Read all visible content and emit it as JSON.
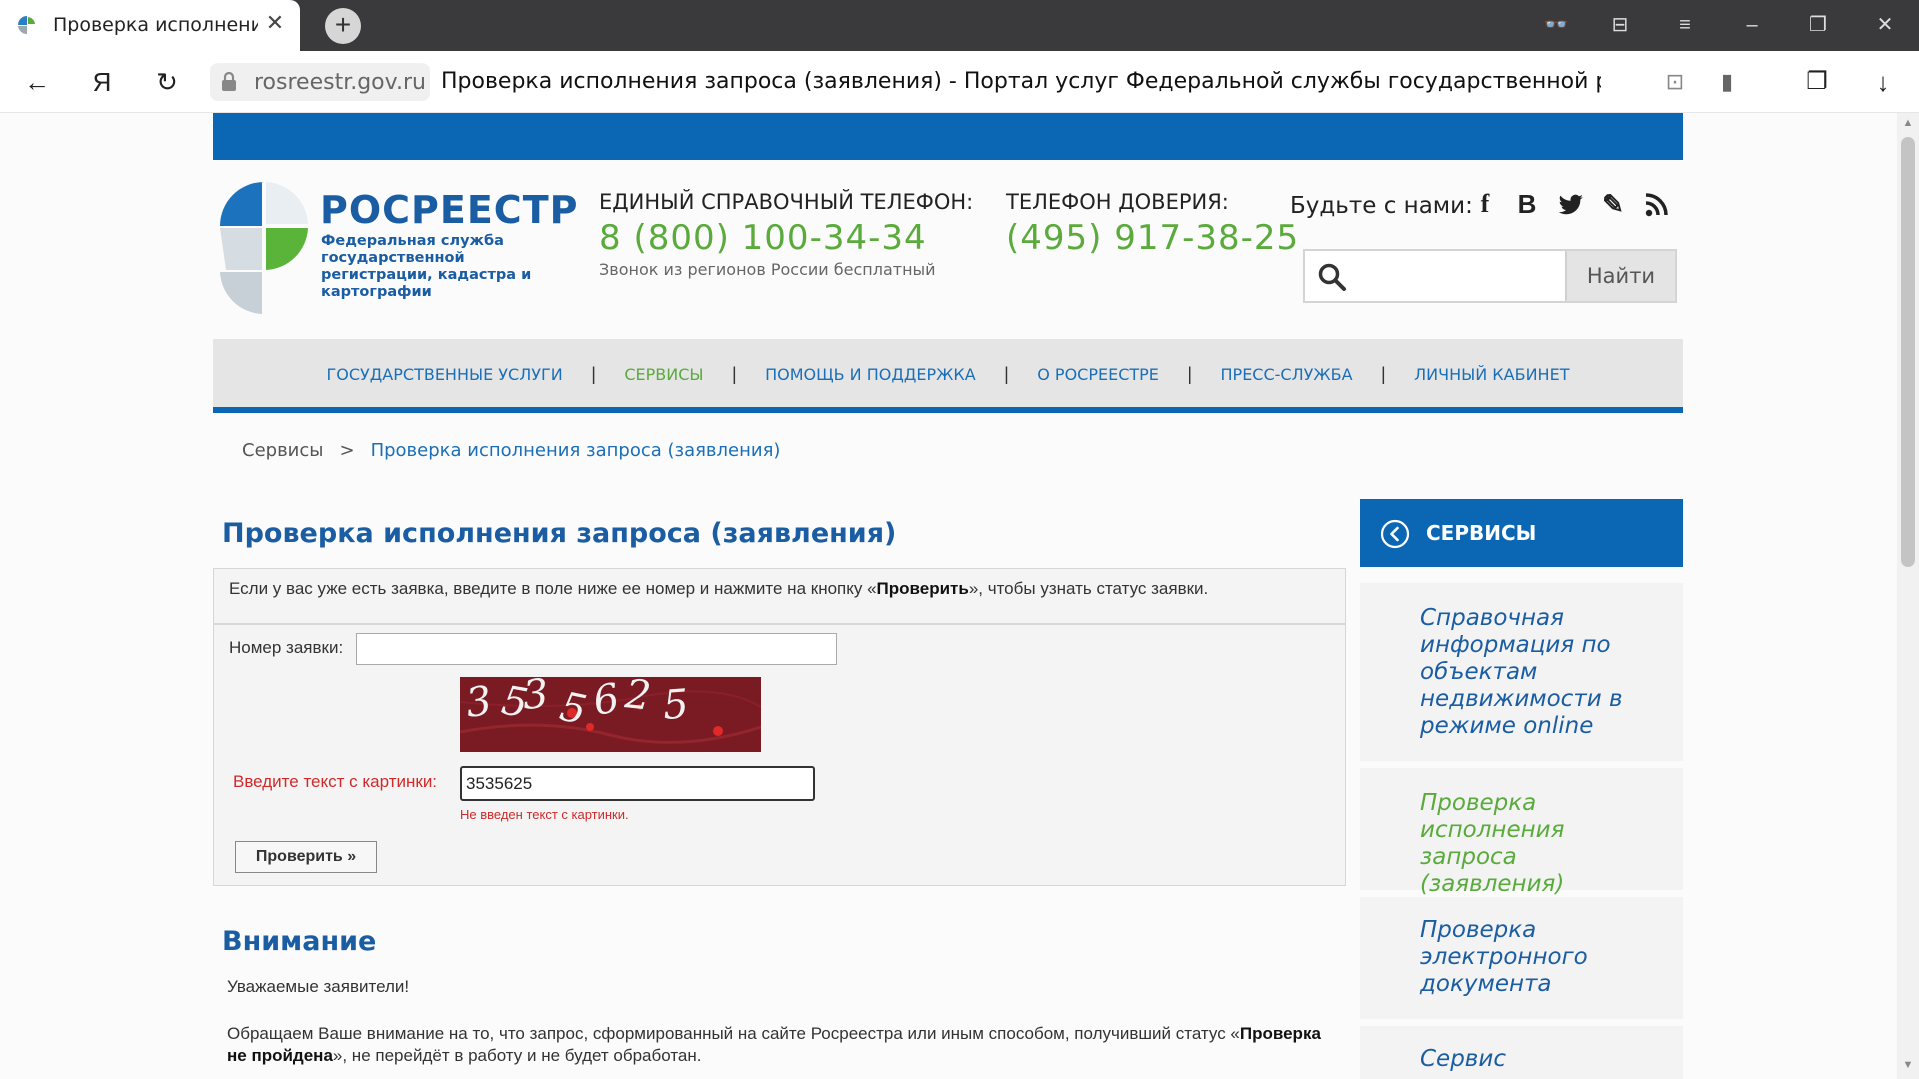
{
  "browser": {
    "tab_title": "Проверка исполнения запроса (заявления)",
    "tab_close": "✕",
    "new_tab": "+",
    "domain": "rosreestr.gov.ru",
    "page_title": "Проверка исполнения запроса (заявления) - Портал услуг Федеральной службы государственной регистрации, кадастра и картографии",
    "nav": {
      "back": "←",
      "yandex": "Я",
      "reload": "↻"
    },
    "right_icons": {
      "translate": "⊡",
      "bookmark": "▮",
      "collections": "❐",
      "download": "↓"
    },
    "window": {
      "reader": "👓",
      "bookmarks": "⊟",
      "menu": "≡",
      "minimize": "–",
      "restore": "❐",
      "close": "✕"
    }
  },
  "header": {
    "logo_name": "РОСРЕЕСТР",
    "logo_subtitle": "Федеральная служба государственной регистрации, кадастра и картографии",
    "hotline_label": "ЕДИНЫЙ СПРАВОЧНЫЙ ТЕЛЕФОН:",
    "hotline_number": "8 (800) 100-34-34",
    "hotline_note": "Звонок из регионов России бесплатный",
    "trust_label": "ТЕЛЕФОН ДОВЕРИЯ:",
    "trust_number": "(495) 917-38-25",
    "social_label": "Будьте с нами:",
    "social_icons": [
      "facebook-icon",
      "vk-icon",
      "twitter-icon",
      "livejournal-icon",
      "rss-icon"
    ],
    "social_glyphs": {
      "facebook": "f",
      "vk": "B",
      "twitter": "🐦",
      "livejournal": "✎",
      "rss": "◔"
    },
    "search_button": "Найти"
  },
  "menu": {
    "items": [
      {
        "label": "ГОСУДАРСТВЕННЫЕ УСЛУГИ"
      },
      {
        "label": "СЕРВИСЫ"
      },
      {
        "label": "ПОМОЩЬ И ПОДДЕРЖКА"
      },
      {
        "label": "О РОСРЕЕСТРЕ"
      },
      {
        "label": "ПРЕСС-СЛУЖБА"
      },
      {
        "label": "ЛИЧНЫЙ КАБИНЕТ"
      }
    ],
    "separator": "|"
  },
  "breadcrumb": {
    "first": "Сервисы",
    "separator": ">",
    "current": "Проверка исполнения запроса (заявления)"
  },
  "main": {
    "title": "Проверка исполнения запроса (заявления)",
    "intro_before": "Если у вас уже есть заявка, введите в поле ниже ее номер и нажмите на кнопку «",
    "intro_bold": "Проверить",
    "intro_after": "», чтобы узнать статус заявки.",
    "number_label": "Номер заявки:",
    "number_value": "",
    "captcha_text": "3535625",
    "captcha_label": "Введите текст с картинки:",
    "captcha_value": "3535625",
    "captcha_error": "Не введен текст с картинки.",
    "check_button": "Проверить »",
    "attention_title": "Внимание",
    "greeting": "Уважаемые заявители!",
    "notice_before": "Обращаем Ваше внимание на то, что запрос, сформированный на сайте Росреестра или иным способом, получивший статус «",
    "notice_bold": "Проверка не пройдена",
    "notice_after": "», не перейдёт в работу и не будет обработан."
  },
  "sidebar": {
    "title": "СЕРВИСЫ",
    "items": [
      {
        "label": "Справочная информация по объектам недвижимости в режиме online"
      },
      {
        "label": "Проверка исполнения запроса (заявления)"
      },
      {
        "label": "Проверка электронного документа"
      },
      {
        "label": "Сервис"
      }
    ]
  },
  "colors": {
    "brand_blue": "#0b67b4",
    "link_blue": "#1a6fb8",
    "accent_green": "#5aaa3c",
    "error_red": "#d02a2a"
  }
}
